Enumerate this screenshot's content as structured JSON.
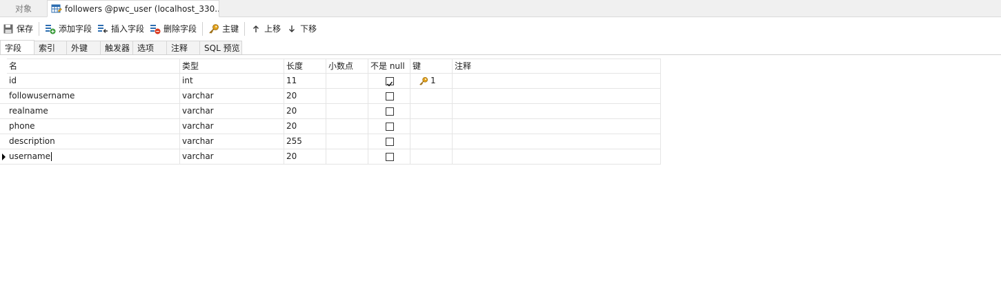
{
  "tabs": {
    "objects_label": "对象",
    "active_label": "followers @pwc_user (localhost_330..."
  },
  "toolbar": {
    "save": "保存",
    "add_field": "添加字段",
    "insert_field": "插入字段",
    "delete_field": "删除字段",
    "primary_key": "主键",
    "move_up": "上移",
    "move_down": "下移"
  },
  "subtabs": [
    "字段",
    "索引",
    "外键",
    "触发器",
    "选项",
    "注释",
    "SQL 预览"
  ],
  "grid": {
    "headers": [
      "名",
      "类型",
      "长度",
      "小数点",
      "不是 null",
      "键",
      "注释"
    ],
    "rows": [
      {
        "name": "id",
        "type": "int",
        "length": "11",
        "decimals": "",
        "not_null": true,
        "key": "1",
        "comment": ""
      },
      {
        "name": "followusername",
        "type": "varchar",
        "length": "20",
        "decimals": "",
        "not_null": false,
        "key": "",
        "comment": ""
      },
      {
        "name": "realname",
        "type": "varchar",
        "length": "20",
        "decimals": "",
        "not_null": false,
        "key": "",
        "comment": ""
      },
      {
        "name": "phone",
        "type": "varchar",
        "length": "20",
        "decimals": "",
        "not_null": false,
        "key": "",
        "comment": ""
      },
      {
        "name": "description",
        "type": "varchar",
        "length": "255",
        "decimals": "",
        "not_null": false,
        "key": "",
        "comment": ""
      },
      {
        "name": "username",
        "type": "varchar",
        "length": "20",
        "decimals": "",
        "not_null": false,
        "key": "",
        "comment": ""
      }
    ]
  },
  "colors": {
    "key_gold": "#e2a21b",
    "accent_blue": "#2b6cb0",
    "delete_red": "#d9381e",
    "add_green": "#3a9a3a"
  }
}
